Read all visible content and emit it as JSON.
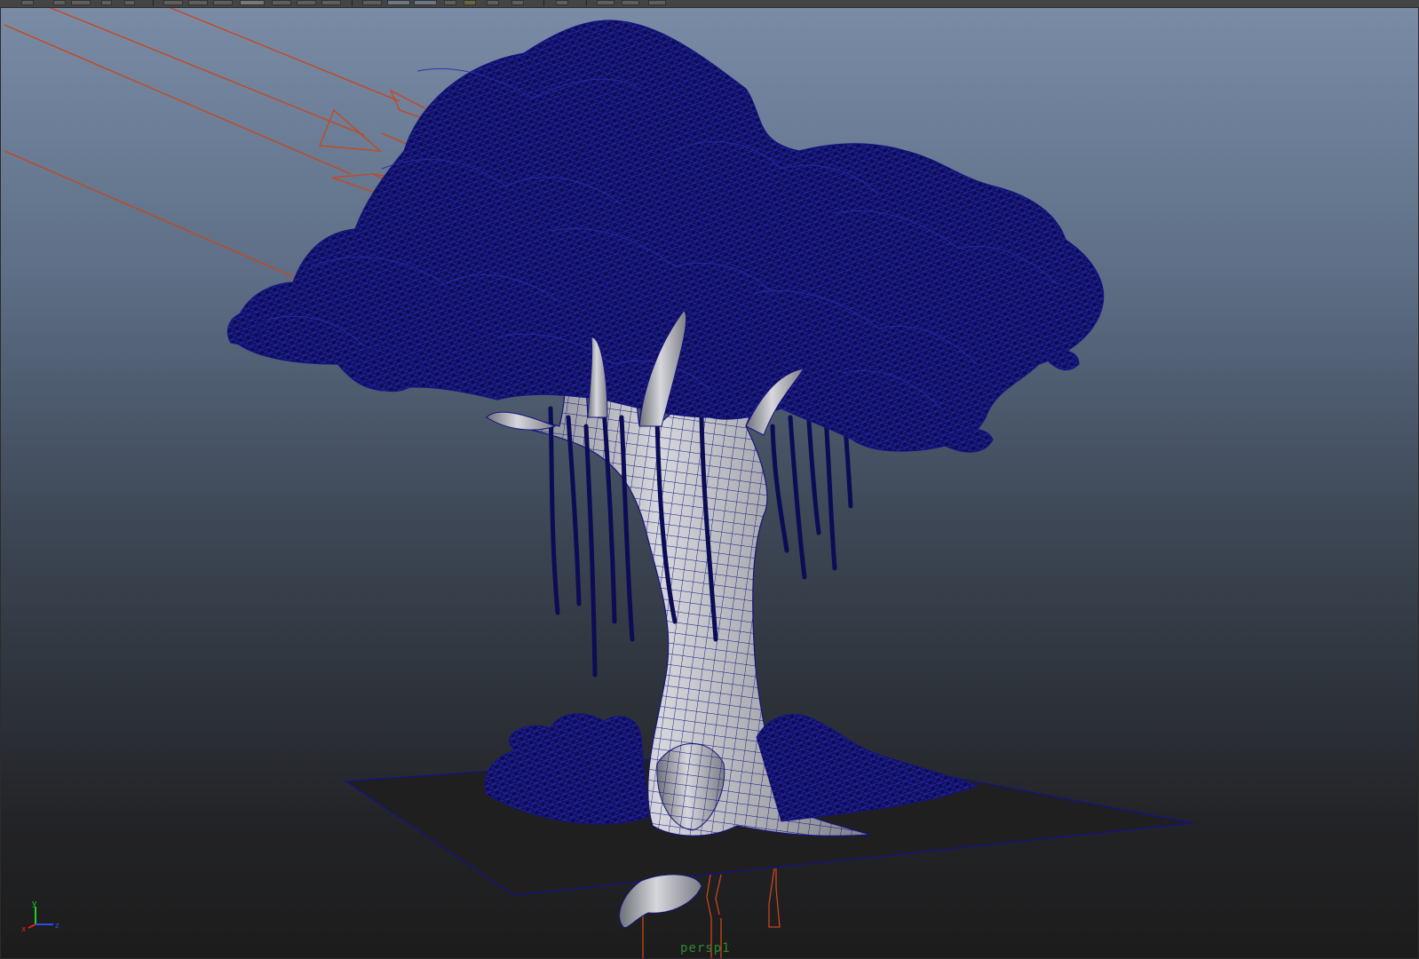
{
  "app": {
    "title": ""
  },
  "viewport": {
    "camera_label": "persp1",
    "background_top": "#7a8ba6",
    "background_bottom": "#1c1c1c"
  },
  "colors": {
    "wireframe": "#14147e",
    "foliage_dark": "#0c0c55",
    "bark": "#b4b6bc",
    "light_lines": "#c8461a",
    "ground_plane": "#1f1f1f",
    "axis_x": "#e02020",
    "axis_y": "#22cc22",
    "axis_z": "#2a4df0"
  },
  "axis_gizmo": {
    "x_label": "x",
    "y_label": "y",
    "z_label": "z"
  },
  "toolbar": {
    "icons": [
      "select-tool-icon",
      "lasso-tool-icon",
      "move-tool-icon",
      "rotate-tool-icon",
      "scale-tool-icon",
      "camera-icon",
      "grid-icon",
      "wireframe-shading-icon",
      "smooth-shading-icon",
      "texture-icon",
      "light-icon",
      "shadow-icon",
      "isolate-icon"
    ]
  },
  "scene_objects": [
    "banyan-tree-mesh",
    "directional-light",
    "ground-plane",
    "persp-camera"
  ]
}
